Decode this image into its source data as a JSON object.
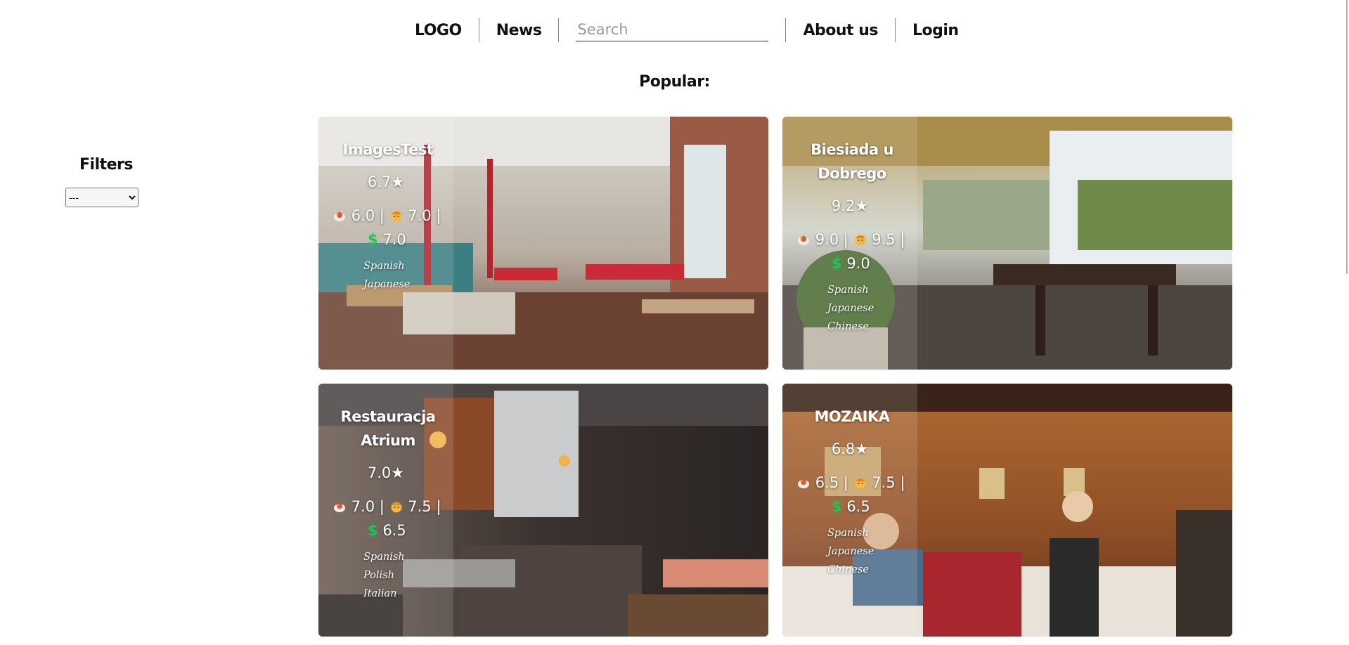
{
  "nav": {
    "logo": "LOGO",
    "news": "News",
    "search_placeholder": "Search",
    "about": "About us",
    "login": "Login"
  },
  "popular_title": "Popular:",
  "filters": {
    "title": "Filters",
    "selected": "---"
  },
  "cards": [
    {
      "name": "ImagesTest",
      "rating": "6.7★",
      "food": "6.0",
      "service": "7.0",
      "price": "7.0",
      "tags": [
        "Spanish",
        "Japanese"
      ]
    },
    {
      "name": "Biesiada u Dobrego",
      "rating": "9.2★",
      "food": "9.0",
      "service": "9.5",
      "price": "9.0",
      "tags": [
        "Spanish",
        "Japanese",
        "Chinese"
      ]
    },
    {
      "name": "Restauracja Atrium",
      "rating": "7.0★",
      "food": "7.0",
      "service": "7.5",
      "price": "6.5",
      "tags": [
        "Spanish",
        "Polish",
        "Italian"
      ]
    },
    {
      "name": "MOZAIKA",
      "rating": "6.8★",
      "food": "6.5",
      "service": "7.5",
      "price": "6.5",
      "tags": [
        "Spanish",
        "Japanese",
        "Chinese"
      ]
    }
  ],
  "symbols": {
    "separator": "|",
    "dollar": "$"
  },
  "icons": {
    "food": "food-bowl-icon",
    "service": "waiter-face-icon",
    "price": "dollar-icon"
  }
}
